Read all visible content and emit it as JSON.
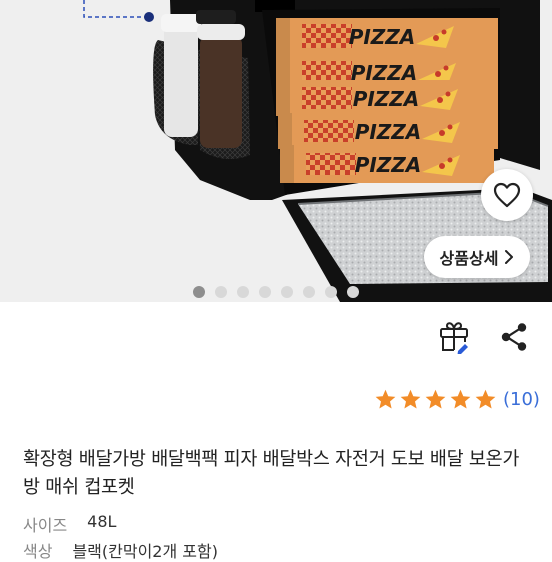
{
  "product": {
    "box_label": "PIZZA",
    "detail_button_label": "상품상세",
    "title": "확장형 배달가방 배달백팩 피자 배달박스 자전거 도보 배달 보온가방 매쉬 컵포켓",
    "rating": {
      "stars": 5,
      "review_count": "(10)"
    },
    "specs": [
      {
        "key": "사이즈",
        "value": "48L"
      },
      {
        "key": "색상",
        "value": "블랙(칸막이2개 포함)"
      }
    ],
    "carousel": {
      "total": 8,
      "active_index": 0
    }
  },
  "icons": {
    "heart": "heart-icon",
    "gift": "gift-icon",
    "share": "share-icon",
    "chevron": "chevron-right-icon",
    "star": "star-icon"
  },
  "colors": {
    "star": "#f28c28",
    "review_link": "#3a6ed8",
    "dot_active": "#8e8e8e",
    "dot_inactive": "#d8d8d8",
    "gift_accent": "#2a5bd7"
  }
}
